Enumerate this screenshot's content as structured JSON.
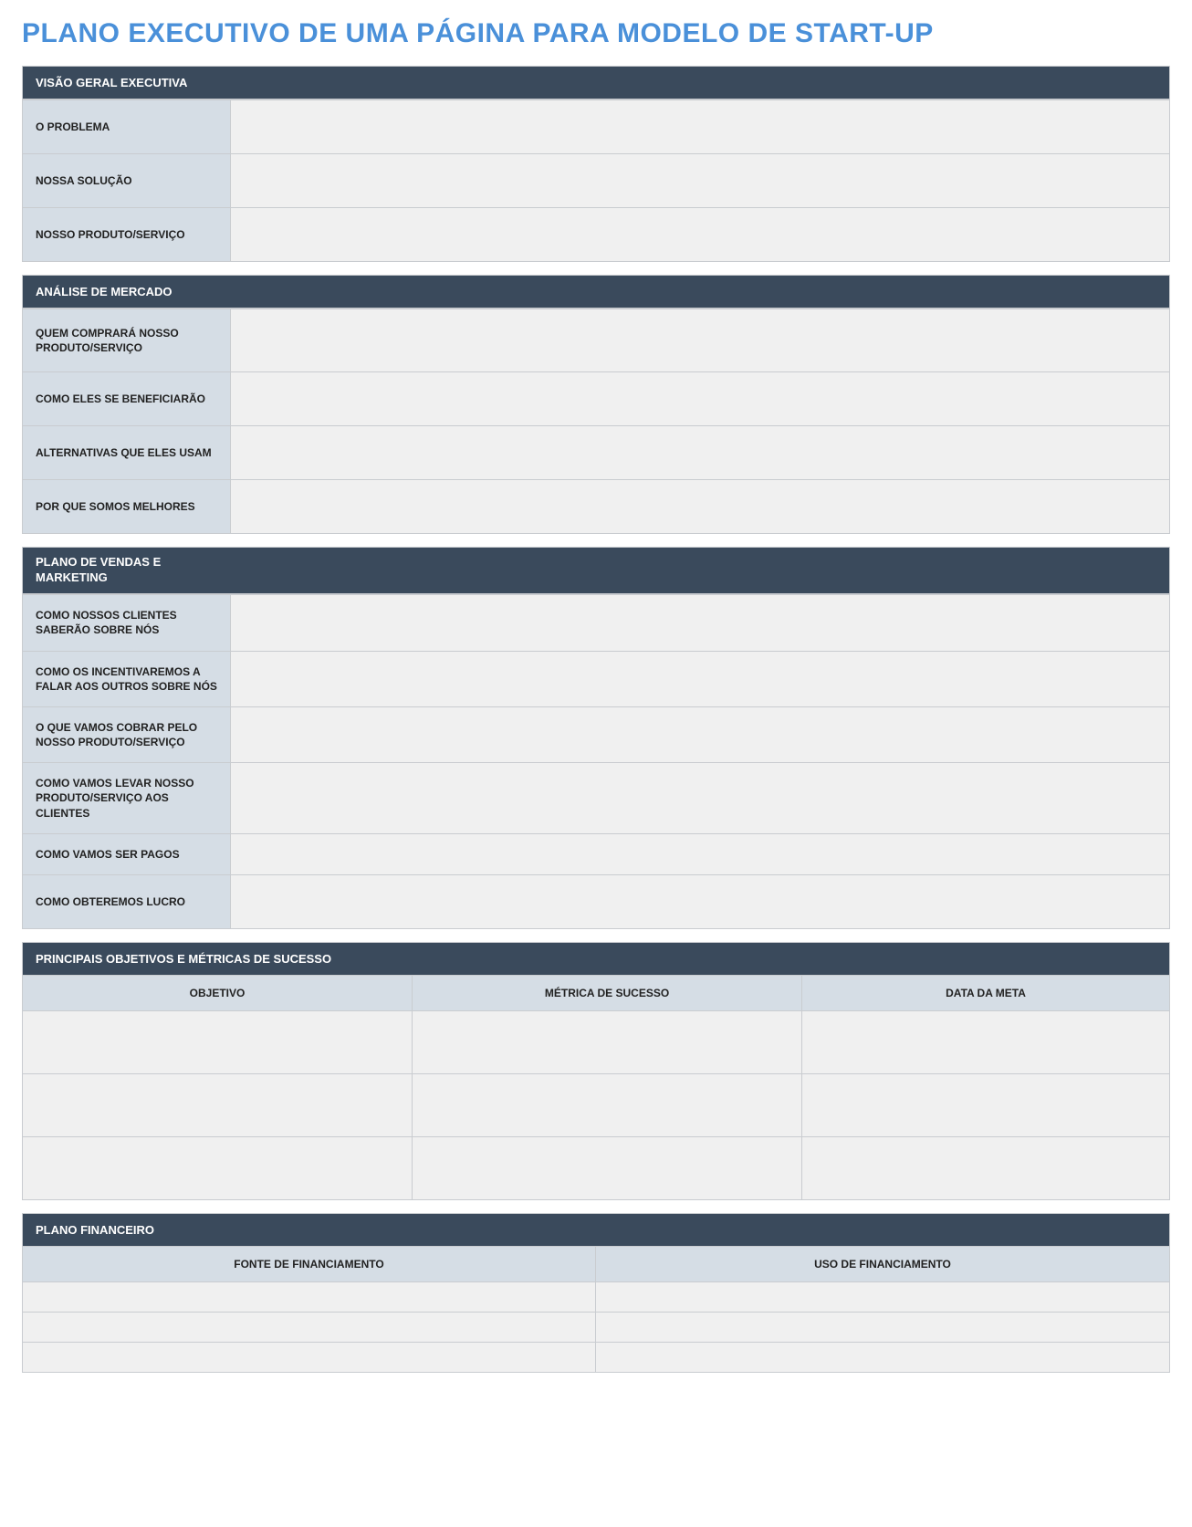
{
  "page_title": "PLANO EXECUTIVO DE UMA PÁGINA PARA MODELO DE START-UP",
  "sections": {
    "overview": {
      "header": "VISÃO GERAL EXECUTIVA",
      "rows": [
        {
          "label": "O PROBLEMA",
          "value": ""
        },
        {
          "label": "NOSSA SOLUÇÃO",
          "value": ""
        },
        {
          "label": "NOSSO PRODUTO/SERVIÇO",
          "value": ""
        }
      ]
    },
    "market": {
      "header": "ANÁLISE DE MERCADO",
      "rows": [
        {
          "label": "QUEM COMPRARÁ NOSSO PRODUTO/SERVIÇO",
          "value": ""
        },
        {
          "label": "COMO ELES SE BENEFICIARÃO",
          "value": ""
        },
        {
          "label": "ALTERNATIVAS QUE ELES USAM",
          "value": ""
        },
        {
          "label": "POR QUE SOMOS MELHORES",
          "value": ""
        }
      ]
    },
    "sales": {
      "header": "PLANO DE VENDAS E MARKETING",
      "rows": [
        {
          "label": "COMO NOSSOS CLIENTES SABERÃO SOBRE NÓS",
          "value": ""
        },
        {
          "label": "COMO OS INCENTIVAREMOS A FALAR AOS OUTROS SOBRE NÓS",
          "value": ""
        },
        {
          "label": "O QUE VAMOS COBRAR PELO NOSSO PRODUTO/SERVIÇO",
          "value": ""
        },
        {
          "label": "COMO VAMOS LEVAR NOSSO PRODUTO/SERVIÇO AOS CLIENTES",
          "value": ""
        },
        {
          "label": "COMO VAMOS SER PAGOS",
          "value": ""
        },
        {
          "label": "COMO OBTEREMOS LUCRO",
          "value": ""
        }
      ]
    },
    "goals": {
      "header": "PRINCIPAIS OBJETIVOS E MÉTRICAS DE SUCESSO",
      "columns": [
        "OBJETIVO",
        "MÉTRICA DE SUCESSO",
        "DATA DA META"
      ],
      "rows": [
        {
          "c1": "",
          "c2": "",
          "c3": ""
        },
        {
          "c1": "",
          "c2": "",
          "c3": ""
        },
        {
          "c1": "",
          "c2": "",
          "c3": ""
        }
      ]
    },
    "finance": {
      "header": "PLANO FINANCEIRO",
      "columns": [
        "FONTE DE FINANCIAMENTO",
        "USO DE FINANCIAMENTO"
      ],
      "rows": [
        {
          "c1": "",
          "c2": ""
        },
        {
          "c1": "",
          "c2": ""
        },
        {
          "c1": "",
          "c2": ""
        }
      ]
    }
  }
}
